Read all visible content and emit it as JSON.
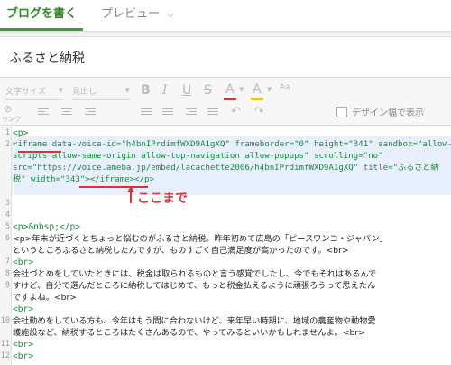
{
  "tabs": {
    "write": "ブログを書く",
    "preview": "プレビュー"
  },
  "title": {
    "value": "ふるさと納税"
  },
  "toolbar": {
    "font_size": "文字サイズ",
    "heading": "見出し",
    "bold": "B",
    "italic": "I",
    "underline": "U",
    "strike": "S",
    "color": "A",
    "link_label": "リンク",
    "design_width": "デザイン幅で表示"
  },
  "editor": {
    "line_numbers": [
      "1",
      "2",
      "",
      "",
      "",
      "3",
      "4",
      "5",
      "6",
      "7",
      "8",
      "9",
      "",
      "10",
      "",
      "11",
      "12",
      "13"
    ],
    "lines": {
      "l1": "<p>",
      "l2a": "<iframe data-voice-id=\"h4bnIPrdimfWXD9A1gXQ\" frameborder=\"0\" height=\"341\" sandbox=\"allow-",
      "l2b": "scripts allow-same-origin allow-top-navigation allow-popups\" scrolling=\"no\"",
      "l2c": "src=\"https://voice.ameba.jp/embed/lacachette2006/h4bnIPrdimfWXD9A1gXQ\" title=\"ふるさと納",
      "l2d": "税\" width=\"343\"></iframe></p>",
      "l5": "<p>&nbsp;</p>",
      "l6a": "<p>年末が近づくとちょっと悩むのがふるさと納税。昨年初めて広島の「ピースワンコ・ジャパン」",
      "l6b": "というところふるさと納税したんですが、ものすごく自己満足度が高かったのです。<br>",
      "l7": "<br>",
      "l8a": "会社づとめをしていたときには、税金は取られるものと言う感覚でしたし、今でもそれはあるんで",
      "l8b": "すけど、自分で選んだところに納税してはじめて、もっと税金払えるように頑張ろうって思えたん",
      "l8c": "ですよね。<br>",
      "l9": "<br>",
      "l10a": "会社勤めをしている方も、今年はもう間に合わないけど、来年早い時期に、地域の農産物や動物愛",
      "l10b": "護施設など、納税するところはたくさんあるので、やってみるといいかもしれませんよ。<br>",
      "l11": "<br>",
      "l12": "<br>",
      "l13": "</p>"
    },
    "annotation": "ここまで"
  },
  "colors": {
    "accent": "#3aa02f",
    "annotation": "#e53a3a",
    "highlight": "#e8f0fd"
  }
}
